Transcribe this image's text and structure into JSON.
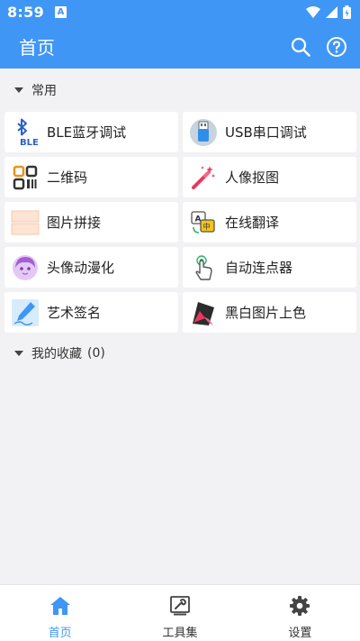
{
  "status_bar": {
    "time": "8:59",
    "notif_glyph": "A"
  },
  "app_bar": {
    "title": "首页",
    "actions": [
      "search-icon",
      "help-icon"
    ]
  },
  "sections": {
    "common": {
      "label": "常用"
    },
    "favorites": {
      "label": "我的收藏",
      "count": "(0)"
    }
  },
  "tools": [
    {
      "label": "BLE蓝牙调试",
      "icon": "bluetooth-icon"
    },
    {
      "label": "USB串口调试",
      "icon": "usb-icon"
    },
    {
      "label": "二维码",
      "icon": "qrcode-icon"
    },
    {
      "label": "人像抠图",
      "icon": "magic-wand-icon"
    },
    {
      "label": "图片拼接",
      "icon": "image-collage-icon"
    },
    {
      "label": "在线翻译",
      "icon": "translate-icon"
    },
    {
      "label": "头像动漫化",
      "icon": "anime-avatar-icon"
    },
    {
      "label": "自动连点器",
      "icon": "tap-icon"
    },
    {
      "label": "艺术签名",
      "icon": "signature-pen-icon"
    },
    {
      "label": "黑白图片上色",
      "icon": "colorize-icon"
    }
  ],
  "bottom_nav": [
    {
      "label": "首页",
      "icon": "home-icon",
      "active": true
    },
    {
      "label": "工具集",
      "icon": "toolbox-icon",
      "active": false
    },
    {
      "label": "设置",
      "icon": "gear-icon",
      "active": false
    }
  ],
  "colors": {
    "primary": "#3f96f5",
    "background": "#f2f2f4",
    "card": "#ffffff"
  }
}
